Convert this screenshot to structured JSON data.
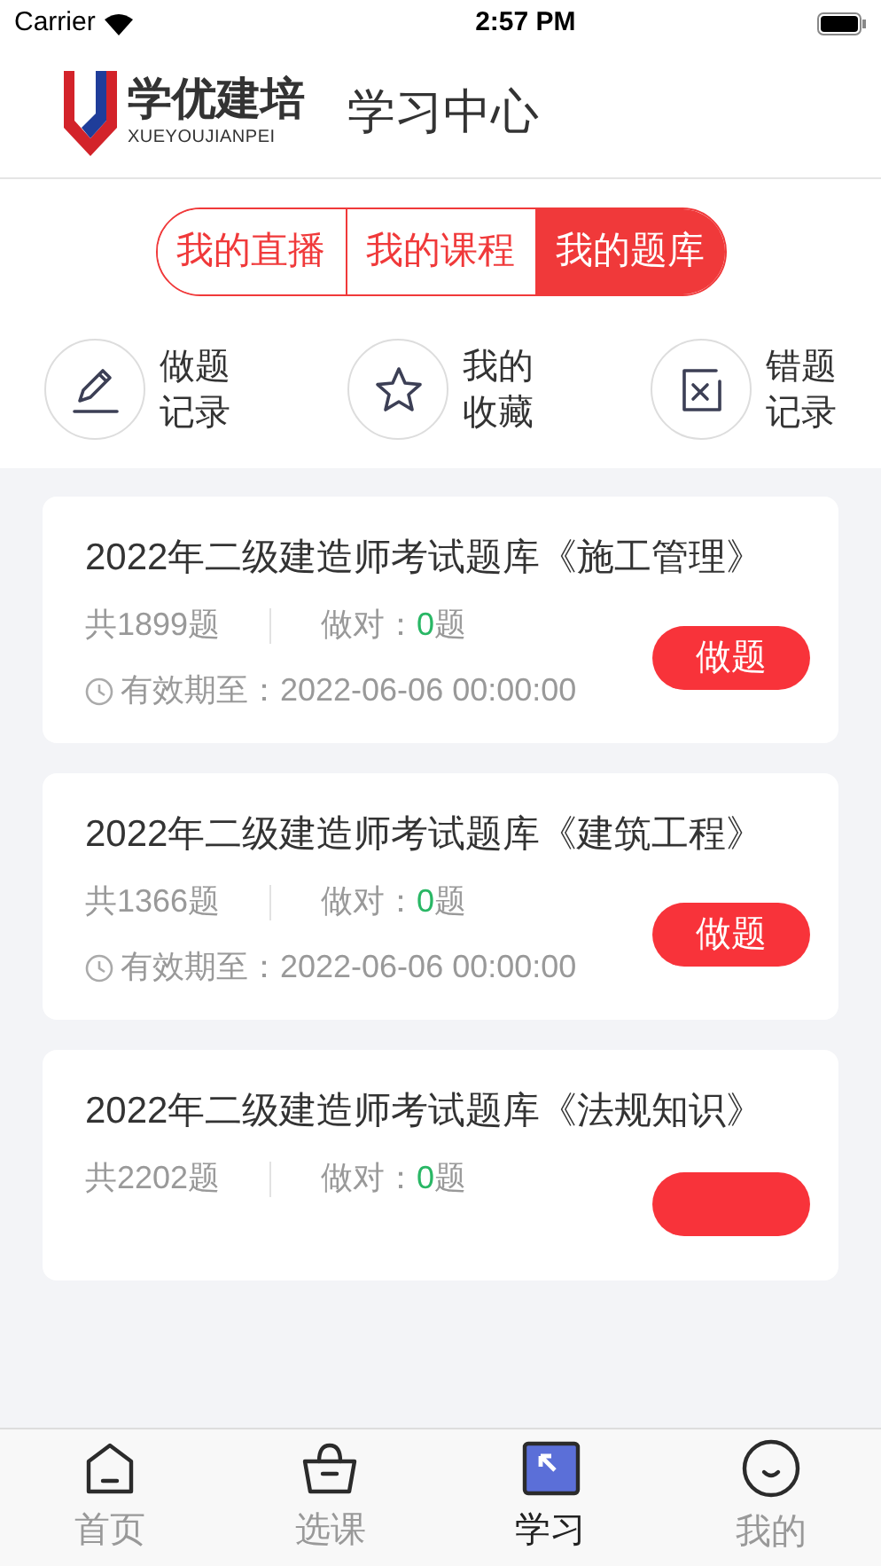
{
  "status_bar": {
    "carrier": "Carrier",
    "time": "2:57 PM"
  },
  "header": {
    "logo_text": "学优建培",
    "logo_subtext": "XUEYOUJIANPEI",
    "title": "学习中心"
  },
  "segments": [
    {
      "label": "我的直播",
      "selected": false
    },
    {
      "label": "我的课程",
      "selected": false
    },
    {
      "label": "我的题库",
      "selected": true
    }
  ],
  "actions": [
    {
      "kind": "pencil",
      "line1": "做题",
      "line2": "记录"
    },
    {
      "kind": "star",
      "line1": "我的",
      "line2": "收藏"
    },
    {
      "kind": "wrong",
      "line1": "错题",
      "line2": "记录"
    }
  ],
  "cards": [
    {
      "kind": "full",
      "title": "2022年二级建造师考试题库《施工管理》",
      "total": "共1899题",
      "correct_label": "做对：",
      "correct_count": "0",
      "correct_unit": "题",
      "expiry": "有效期至：2022-06-06 00:00:00",
      "button": "做题"
    },
    {
      "kind": "full",
      "title": "2022年二级建造师考试题库《建筑工程》",
      "total": "共1366题",
      "correct_label": "做对：",
      "correct_count": "0",
      "correct_unit": "题",
      "expiry": "有效期至：2022-06-06 00:00:00",
      "button": "做题"
    },
    {
      "kind": "cut",
      "title": "2022年二级建造师考试题库《法规知识》",
      "total": "共2202题",
      "correct_label": "做对：",
      "correct_count": "0",
      "correct_unit": "题"
    }
  ],
  "tab_bar": [
    {
      "kind": "home",
      "label": "首页",
      "selected": false
    },
    {
      "kind": "basket",
      "label": "选课",
      "selected": false
    },
    {
      "kind": "study",
      "label": "学习",
      "selected": true
    },
    {
      "kind": "me",
      "label": "我的",
      "selected": false
    }
  ]
}
